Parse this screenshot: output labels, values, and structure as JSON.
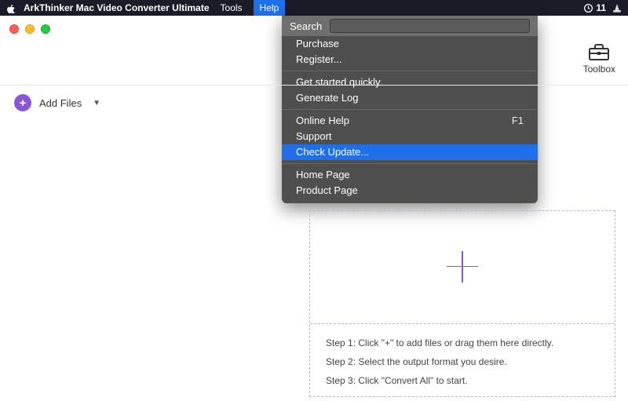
{
  "menubar": {
    "title": "ArkThinker Mac Video Converter Ultimate",
    "items": [
      "Tools",
      "Help"
    ],
    "right_count": "11"
  },
  "help_menu": {
    "search_label": "Search",
    "rows": [
      "Purchase",
      "Register...",
      "Get started quickly",
      "Generate Log",
      "Online Help",
      "Support",
      "Check Update...",
      "Home Page",
      "Product Page"
    ],
    "f1_shortcut": "F1"
  },
  "toolbox_label": "Toolbox",
  "addfiles_label": "Add Files",
  "steps": {
    "s1": "Step 1: Click \"+\" to add files or drag them here directly.",
    "s2": "Step 2: Select the output format you desire.",
    "s3": "Step 3: Click \"Convert All\" to start."
  }
}
